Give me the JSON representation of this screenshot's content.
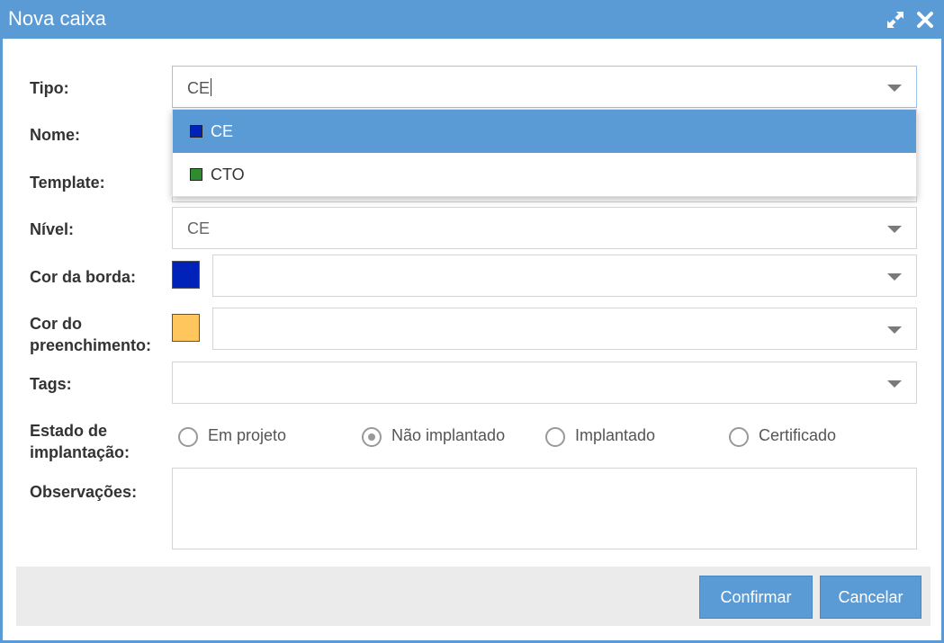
{
  "window": {
    "title": "Nova caixa"
  },
  "fields": {
    "tipo": {
      "label": "Tipo:",
      "value": "CE"
    },
    "nome": {
      "label": "Nome:"
    },
    "template": {
      "label": "Template:"
    },
    "nivel": {
      "label": "Nível:",
      "value": "CE"
    },
    "cor_borda": {
      "label": "Cor da borda:",
      "color": "#0022b8",
      "value": ""
    },
    "cor_preenchimento": {
      "label_line1": "Cor do",
      "label_line2": "preenchimento:",
      "color": "#ffc65e",
      "value": ""
    },
    "tags": {
      "label": "Tags:",
      "value": ""
    },
    "estado": {
      "label_line1": "Estado de",
      "label_line2": "implantação:",
      "options": [
        {
          "label": "Em projeto",
          "selected": false
        },
        {
          "label": "Não implantado",
          "selected": true
        },
        {
          "label": "Implantado",
          "selected": false
        },
        {
          "label": "Certificado",
          "selected": false
        }
      ]
    },
    "observacoes": {
      "label": "Observações:",
      "value": ""
    }
  },
  "tipo_dropdown": {
    "options": [
      {
        "label": "CE",
        "color": "#0022b8",
        "active": true
      },
      {
        "label": "CTO",
        "color": "#2e8b2e",
        "active": false
      }
    ]
  },
  "footer": {
    "confirm_label": "Confirmar",
    "cancel_label": "Cancelar"
  },
  "theme": {
    "accent": "#5b9bd5"
  }
}
